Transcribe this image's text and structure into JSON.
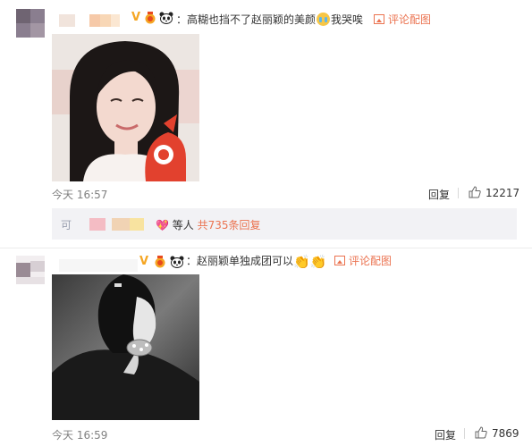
{
  "comments": [
    {
      "badge_v": "V",
      "text": "高糊也挡不了赵丽颖的美颜",
      "text_suffix": "我哭唉",
      "emoji1": "crying-face-icon",
      "pic_link": "评论配图",
      "time": "今天 16:57",
      "reply": "回复",
      "likes": "12217"
    },
    {
      "badge_v": "V",
      "text": "赵丽颖单独成团可以",
      "emoji1": "clapping-hands-icon",
      "pic_link": "评论配图",
      "time": "今天 16:59",
      "reply": "回复",
      "likes": "7869"
    }
  ],
  "sub_reply": {
    "prefix": "可",
    "suffix": "等人",
    "link": "共735条回复"
  },
  "colors": {
    "accent": "#eb7350",
    "subbox": "#f2f2f5",
    "time": "#808080"
  }
}
